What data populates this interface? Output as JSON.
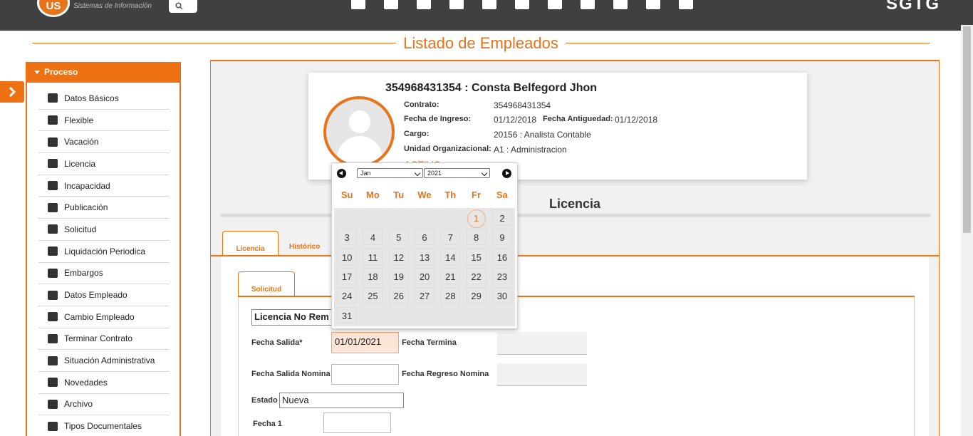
{
  "header": {
    "logo_text": "US",
    "logo_caption": "Sistemas de Información",
    "brand": "SGTG",
    "nav_icons": [
      "edit-icon",
      "team-icon",
      "columns-icon",
      "org-chart-icon",
      "transfer-icon",
      "history-icon",
      "document-icon",
      "easel-icon",
      "settings-icon",
      "location-icon",
      "users-icon"
    ]
  },
  "page": {
    "title": "Listado de Empleados"
  },
  "sidebar": {
    "header": "Proceso",
    "items": [
      {
        "label": "Datos Básicos",
        "icon": "user-icon"
      },
      {
        "label": "Flexible",
        "icon": "money-icon"
      },
      {
        "label": "Vacación",
        "icon": "beach-icon"
      },
      {
        "label": "Licencia",
        "icon": "list-icon"
      },
      {
        "label": "Incapacidad",
        "icon": "ledger-icon"
      },
      {
        "label": "Publicación",
        "icon": "pen-icon"
      },
      {
        "label": "Solicitud",
        "icon": "form-icon"
      },
      {
        "label": "Liquidación Periodica",
        "icon": "download-icon"
      },
      {
        "label": "Embargos",
        "icon": "calculator-icon"
      },
      {
        "label": "Datos Empleado",
        "icon": "id-card-icon"
      },
      {
        "label": "Cambio Empleado",
        "icon": "user-change-icon"
      },
      {
        "label": "Terminar Contrato",
        "icon": "user-remove-icon"
      },
      {
        "label": "Situación Administrativa",
        "icon": "file-user-icon"
      },
      {
        "label": "Novedades",
        "icon": "comment-icon"
      },
      {
        "label": "Archivo",
        "icon": "folder-icon"
      },
      {
        "label": "Tipos Documentales",
        "icon": "folder-open-icon"
      }
    ]
  },
  "employee": {
    "name": "354968431354 : Consta Belfegord Jhon",
    "contrato_label": "Contrato:",
    "contrato": "354968431354",
    "ingreso_label": "Fecha de Ingreso:",
    "ingreso": "01/12/2018",
    "antiguedad_label": "Fecha Antiguedad:",
    "antiguedad": "01/12/2018",
    "cargo_label": "Cargo:",
    "cargo": "20156 : Analista Contable",
    "unidad_label": "Unidad Organizacional:",
    "unidad": "A1 : Administracion",
    "status": "ACTIVO"
  },
  "section": {
    "title": "Licencia"
  },
  "tabs": [
    {
      "label": "Licencia",
      "active": true
    },
    {
      "label": "Histórico",
      "active": false
    }
  ],
  "subtabs": [
    {
      "label": "Solicitud",
      "active": true
    }
  ],
  "form": {
    "tipo_value": "Licencia No Rem",
    "fecha_salida_label": "Fecha Salida*",
    "fecha_salida_value": "01/01/2021",
    "fecha_termina_label": "Fecha Termina",
    "fecha_termina_value": "",
    "fecha_salida_nomina_label": "Fecha Salida Nomina",
    "fecha_salida_nomina_value": "",
    "fecha_regreso_nomina_label": "Fecha Regreso Nomina",
    "fecha_regreso_nomina_value": "",
    "estado_label": "Estado",
    "estado_value": "Nueva",
    "fecha1_label": "Fecha 1",
    "fecha1_value": ""
  },
  "calendar": {
    "month": "Jan",
    "year": "2021",
    "weekdays": [
      "Su",
      "Mo",
      "Tu",
      "We",
      "Th",
      "Fr",
      "Sa"
    ],
    "first_weekday_index": 5,
    "days_in_month": 31,
    "selected_day": 1,
    "accent": "#e8731a"
  },
  "colors": {
    "accent": "#ee7113",
    "topbar": "#404040"
  }
}
